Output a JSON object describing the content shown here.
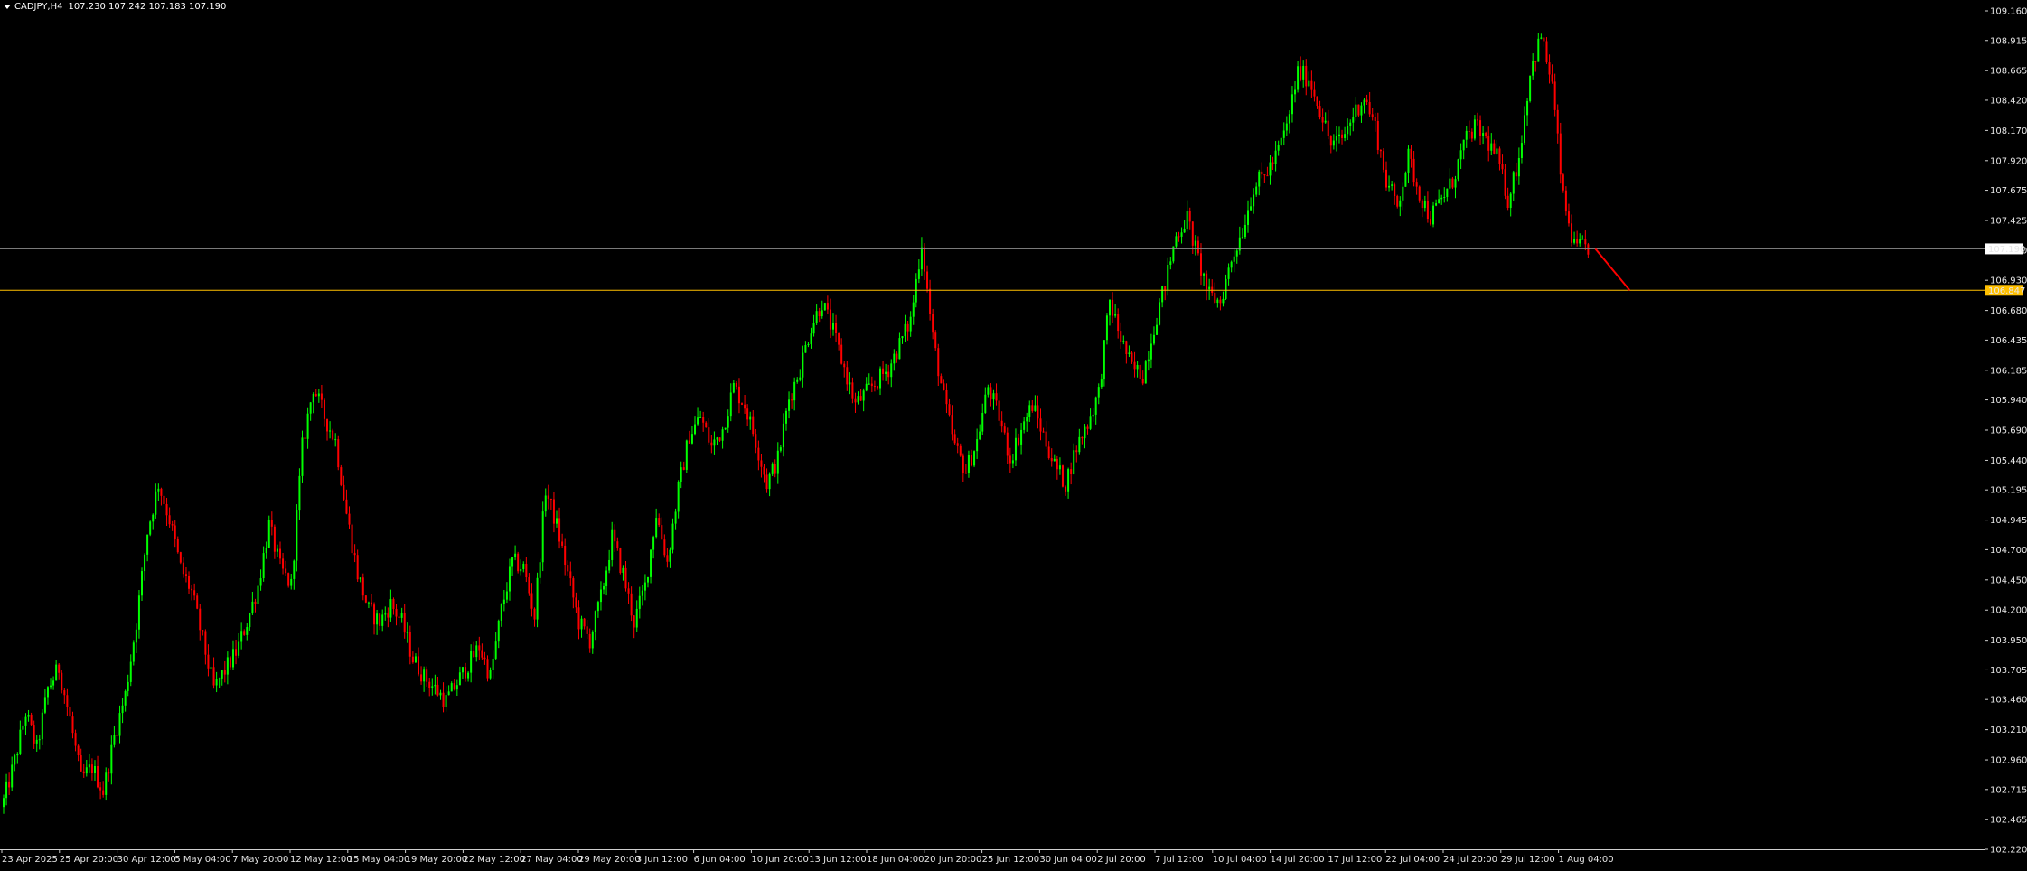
{
  "header": {
    "symbol_text": "CADJPY,H4",
    "ohlc_text": "107.230 107.242 107.183 107.190"
  },
  "colors": {
    "background": "#000000",
    "bull": "#00ff00",
    "bear": "#ff0000",
    "axis": "#e6e6e6",
    "bid_line": "#8c8c8c",
    "level_line": "#ffc000",
    "projection": "#ff0000"
  },
  "chart_data": {
    "type": "candlestick",
    "timeframe": "H4",
    "y_ticks": [
      "109.160",
      "108.915",
      "108.665",
      "108.420",
      "108.170",
      "107.920",
      "107.675",
      "107.425",
      "107.180",
      "106.930",
      "106.680",
      "106.435",
      "106.185",
      "105.940",
      "105.690",
      "105.440",
      "105.195",
      "104.945",
      "104.700",
      "104.450",
      "104.200",
      "103.950",
      "103.705",
      "103.460",
      "103.210",
      "102.960",
      "102.715",
      "102.465",
      "102.220"
    ],
    "ylim": [
      102.22,
      109.16
    ],
    "x_tick_labels": [
      "23 Apr 2025",
      "25 Apr 20:00",
      "30 Apr 12:00",
      "5 May 04:00",
      "7 May 20:00",
      "12 May 12:00",
      "15 May 04:00",
      "19 May 20:00",
      "22 May 12:00",
      "27 May 04:00",
      "29 May 20:00",
      "3 Jun 12:00",
      "6 Jun 04:00",
      "10 Jun 20:00",
      "13 Jun 12:00",
      "18 Jun 04:00",
      "20 Jun 20:00",
      "25 Jun 12:00",
      "30 Jun 04:00",
      "2 Jul 20:00",
      "7 Jul 12:00",
      "10 Jul 04:00",
      "14 Jul 20:00",
      "17 Jul 12:00",
      "22 Jul 04:00",
      "24 Jul 20:00",
      "29 Jul 12:00",
      "1 Aug 04:00"
    ],
    "current_price": {
      "label": "107.190",
      "value": 107.19
    },
    "level": {
      "label": "106.847",
      "value": 106.847
    },
    "projection": {
      "from": 107.19,
      "to": 106.847
    },
    "close_path": [
      [
        0,
        102.62
      ],
      [
        4,
        102.95
      ],
      [
        8,
        103.35
      ],
      [
        12,
        103.05
      ],
      [
        16,
        103.55
      ],
      [
        20,
        103.72
      ],
      [
        24,
        103.3
      ],
      [
        28,
        102.8
      ],
      [
        32,
        102.9
      ],
      [
        36,
        102.7
      ],
      [
        40,
        103.15
      ],
      [
        44,
        103.5
      ],
      [
        48,
        104.1
      ],
      [
        52,
        104.85
      ],
      [
        56,
        105.25
      ],
      [
        60,
        104.95
      ],
      [
        64,
        104.55
      ],
      [
        68,
        104.35
      ],
      [
        72,
        103.95
      ],
      [
        76,
        103.55
      ],
      [
        80,
        103.7
      ],
      [
        84,
        103.85
      ],
      [
        88,
        104.1
      ],
      [
        92,
        104.4
      ],
      [
        96,
        104.9
      ],
      [
        100,
        104.55
      ],
      [
        104,
        104.4
      ],
      [
        108,
        105.55
      ],
      [
        112,
        106.05
      ],
      [
        116,
        105.8
      ],
      [
        120,
        105.6
      ],
      [
        124,
        105.0
      ],
      [
        128,
        104.5
      ],
      [
        132,
        104.2
      ],
      [
        136,
        104.1
      ],
      [
        140,
        104.25
      ],
      [
        144,
        104.1
      ],
      [
        148,
        103.8
      ],
      [
        152,
        103.65
      ],
      [
        156,
        103.55
      ],
      [
        160,
        103.45
      ],
      [
        164,
        103.6
      ],
      [
        168,
        103.75
      ],
      [
        172,
        103.9
      ],
      [
        176,
        103.65
      ],
      [
        180,
        104.2
      ],
      [
        184,
        104.6
      ],
      [
        188,
        104.55
      ],
      [
        192,
        104.15
      ],
      [
        196,
        105.2
      ],
      [
        200,
        104.9
      ],
      [
        204,
        104.5
      ],
      [
        208,
        104.1
      ],
      [
        212,
        103.95
      ],
      [
        216,
        104.3
      ],
      [
        220,
        104.8
      ],
      [
        224,
        104.5
      ],
      [
        228,
        104.1
      ],
      [
        232,
        104.4
      ],
      [
        236,
        105.0
      ],
      [
        240,
        104.6
      ],
      [
        244,
        105.2
      ],
      [
        248,
        105.65
      ],
      [
        252,
        105.8
      ],
      [
        256,
        105.55
      ],
      [
        260,
        105.7
      ],
      [
        264,
        106.05
      ],
      [
        268,
        105.9
      ],
      [
        272,
        105.6
      ],
      [
        276,
        105.25
      ],
      [
        280,
        105.45
      ],
      [
        284,
        105.95
      ],
      [
        288,
        106.2
      ],
      [
        292,
        106.55
      ],
      [
        296,
        106.75
      ],
      [
        300,
        106.5
      ],
      [
        304,
        106.2
      ],
      [
        308,
        105.9
      ],
      [
        312,
        106.0
      ],
      [
        316,
        106.1
      ],
      [
        320,
        106.2
      ],
      [
        324,
        106.4
      ],
      [
        328,
        106.6
      ],
      [
        332,
        107.25
      ],
      [
        336,
        106.45
      ],
      [
        340,
        105.95
      ],
      [
        344,
        105.55
      ],
      [
        348,
        105.35
      ],
      [
        352,
        105.6
      ],
      [
        356,
        106.05
      ],
      [
        360,
        105.8
      ],
      [
        364,
        105.45
      ],
      [
        368,
        105.7
      ],
      [
        372,
        105.9
      ],
      [
        376,
        105.65
      ],
      [
        380,
        105.4
      ],
      [
        384,
        105.25
      ],
      [
        388,
        105.55
      ],
      [
        392,
        105.75
      ],
      [
        396,
        106.0
      ],
      [
        400,
        106.75
      ],
      [
        404,
        106.45
      ],
      [
        408,
        106.2
      ],
      [
        412,
        106.15
      ],
      [
        416,
        106.55
      ],
      [
        420,
        106.9
      ],
      [
        424,
        107.3
      ],
      [
        428,
        107.45
      ],
      [
        432,
        107.1
      ],
      [
        436,
        106.8
      ],
      [
        440,
        106.75
      ],
      [
        444,
        107.1
      ],
      [
        448,
        107.35
      ],
      [
        452,
        107.7
      ],
      [
        456,
        107.8
      ],
      [
        460,
        107.95
      ],
      [
        464,
        108.2
      ],
      [
        468,
        108.65
      ],
      [
        472,
        108.6
      ],
      [
        476,
        108.35
      ],
      [
        480,
        108.05
      ],
      [
        484,
        108.1
      ],
      [
        488,
        108.3
      ],
      [
        492,
        108.45
      ],
      [
        496,
        108.2
      ],
      [
        500,
        107.75
      ],
      [
        504,
        107.55
      ],
      [
        508,
        107.95
      ],
      [
        512,
        107.65
      ],
      [
        516,
        107.45
      ],
      [
        520,
        107.6
      ],
      [
        524,
        107.75
      ],
      [
        528,
        108.05
      ],
      [
        532,
        108.2
      ],
      [
        536,
        108.1
      ],
      [
        540,
        107.95
      ],
      [
        544,
        107.6
      ],
      [
        548,
        107.95
      ],
      [
        552,
        108.65
      ],
      [
        556,
        108.95
      ],
      [
        560,
        108.55
      ],
      [
        564,
        107.6
      ],
      [
        568,
        107.2
      ]
    ]
  }
}
